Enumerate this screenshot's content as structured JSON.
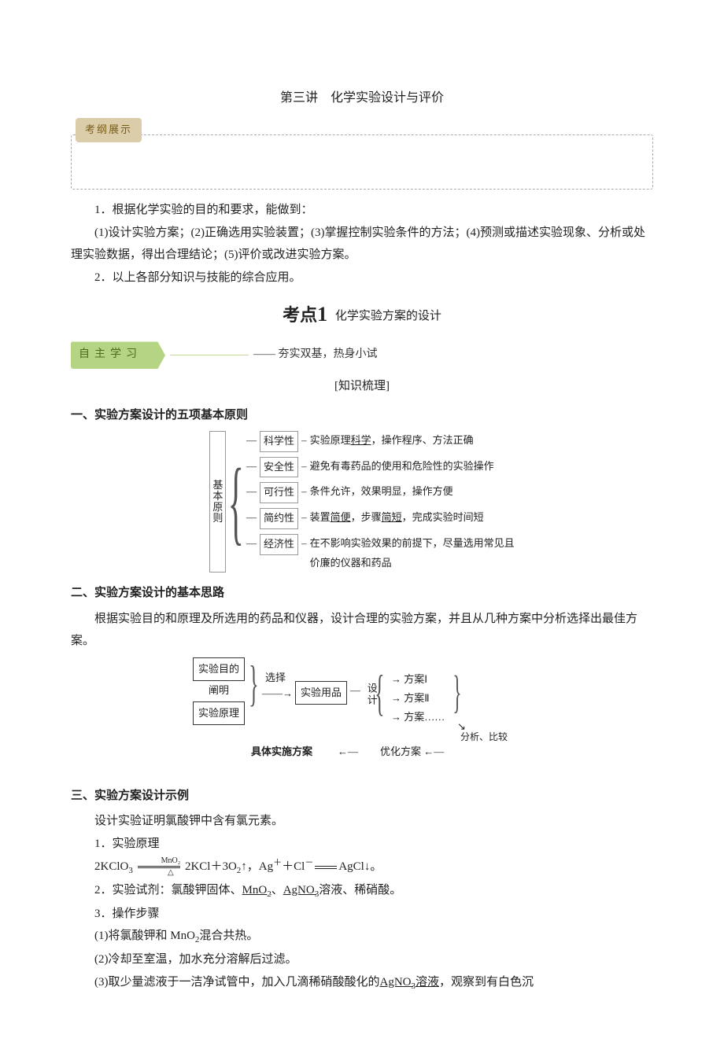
{
  "title": "第三讲　化学实验设计与评价",
  "kgan_tab": "考纲展示",
  "syllabus": {
    "s1": "1．根据化学实验的目的和要求，能做到：",
    "s1d": "(1)设计实验方案；(2)正确选用实验装置；(3)掌握控制实验条件的方法；(4)预测或描述实验现象、分析或处理实验数据，得出合理结论；(5)评价或改进实验方案。",
    "s2": "2．以上各部分知识与技能的综合应用。"
  },
  "kaodian": {
    "prefix": "考点",
    "num": "1",
    "sub": "化学实验方案的设计"
  },
  "zzxx": {
    "tab": "自主学习",
    "tail": "夯实双基，热身小试"
  },
  "zhishi": "[知识梳理]",
  "h1": "一、实验方案设计的五项基本原则",
  "principles_root": "基本原则",
  "principles": [
    {
      "tag": "科学性",
      "desc_pre": "实验原理",
      "desc_u": "科学",
      "desc_post": "，操作程序、方法正确"
    },
    {
      "tag": "安全性",
      "desc": "避免有毒药品的使用和危险性的实验操作"
    },
    {
      "tag": "可行性",
      "desc": "条件允许，效果明显，操作方便"
    },
    {
      "tag": "简约性",
      "desc_pre": "装置",
      "desc_u1": "简便",
      "desc_mid": "，步骤",
      "desc_u2": "简短",
      "desc_post": "，完成实验时间短"
    },
    {
      "tag": "经济性",
      "desc": "在不影响实验效果的前提下，尽量选用常见且价廉的仪器和药品"
    }
  ],
  "h2": "二、实验方案设计的基本思路",
  "h2_body": "根据实验目的和原理及所选用的药品和仪器，设计合理的实验方案，并且从几种方案中分析选择出最佳方案。",
  "flow": {
    "b1": "实验目的",
    "b2": "实验原理",
    "b3": "实验用品",
    "mid": "阐明",
    "sel": "选择",
    "she": "设计",
    "f1": "方案Ⅰ",
    "f2": "方案Ⅱ",
    "f3": "方案……",
    "opt": "优化方案",
    "impl": "具体实施方案",
    "cmp": "分析、比较",
    "larrow": "←—"
  },
  "h3": "三、实验方案设计示例",
  "h3_intro": "设计实验证明氯酸钾中含有氯元素。",
  "p1_h": "1．实验原理",
  "eq": {
    "lhs": "2KClO",
    "lhs_sub": "3",
    "cond_top": "MnO₂",
    "cond_bot": "△",
    "mid": " 2KCl＋3O",
    "mid_sub": "2",
    "up": "↑，Ag",
    "plus1": "＋Cl",
    "eqeq": "AgCl↓。",
    "cl_minus": "－",
    "ag_plus": "＋"
  },
  "p2_pre": "2．实验试剂：氯酸钾固体、",
  "p2_u1": "MnO",
  "p2_u1s": "2",
  "p2_mid": "、",
  "p2_u2": "AgNO",
  "p2_u2s": "3",
  "p2_post": "溶液、稀硝酸。",
  "p3_h": "3．操作步骤",
  "step1_pre": "(1)将氯酸钾和 MnO",
  "step1_sub": "2",
  "step1_post": "混合共热。",
  "step2": "(2)冷却至室温，加水充分溶解后过滤。",
  "step3_pre": "(3)取少量滤液于一洁净试管中，加入几滴稀硝酸酸化的",
  "step3_u": "AgNO",
  "step3_us": "3",
  "step3_mid": "溶液",
  "step3_post": "，观察到有白色沉"
}
